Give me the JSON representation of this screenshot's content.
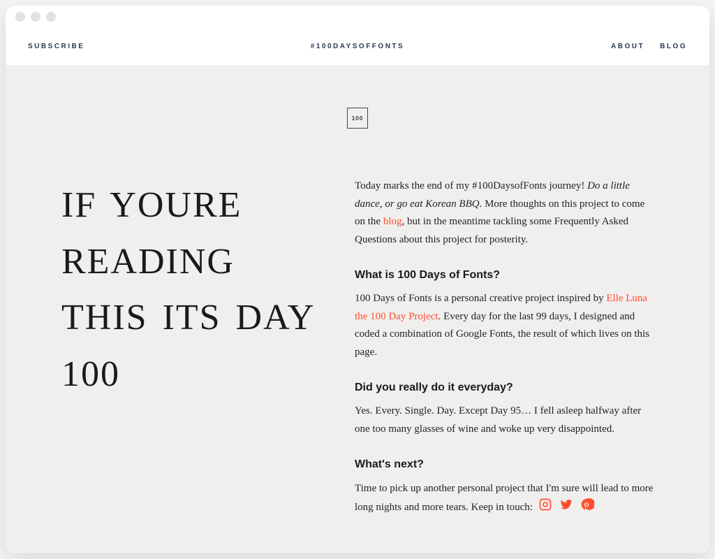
{
  "nav": {
    "subscribe": "SUBSCRIBE",
    "center": "#100DAYSOFFONTS",
    "about": "ABOUT",
    "blog": "BLOG"
  },
  "badge": "100",
  "headline": "If youre reading this its day 100",
  "intro": {
    "lead": "Today marks the end of my #100DaysofFonts journey! ",
    "emphasis": "Do a little dance, or go eat Korean BBQ.",
    "mid": " More thoughts on this project to come on the ",
    "link": "blog",
    "tail": ", but in the meantime tackling some Frequently Asked Questions about this project for posterity."
  },
  "q1": {
    "heading": "What is 100 Days of Fonts?",
    "lead": "100 Days of Fonts is a personal creative project inspired by ",
    "link": "Elle Luna the 100 Day Project",
    "tail": ". Every day for the last 99 days, I designed and coded a combination of Google Fonts, the result of which lives on this page."
  },
  "q2": {
    "heading": "Did you really do it everyday?",
    "body": "Yes. Every. Single. Day. Except Day 95… I fell asleep halfway after one too many glasses of wine and woke up very disappointed."
  },
  "q3": {
    "heading": "What's next?",
    "body": "Time to pick up another personal project that I'm sure will lead to more long nights and more tears. Keep in touch:"
  }
}
